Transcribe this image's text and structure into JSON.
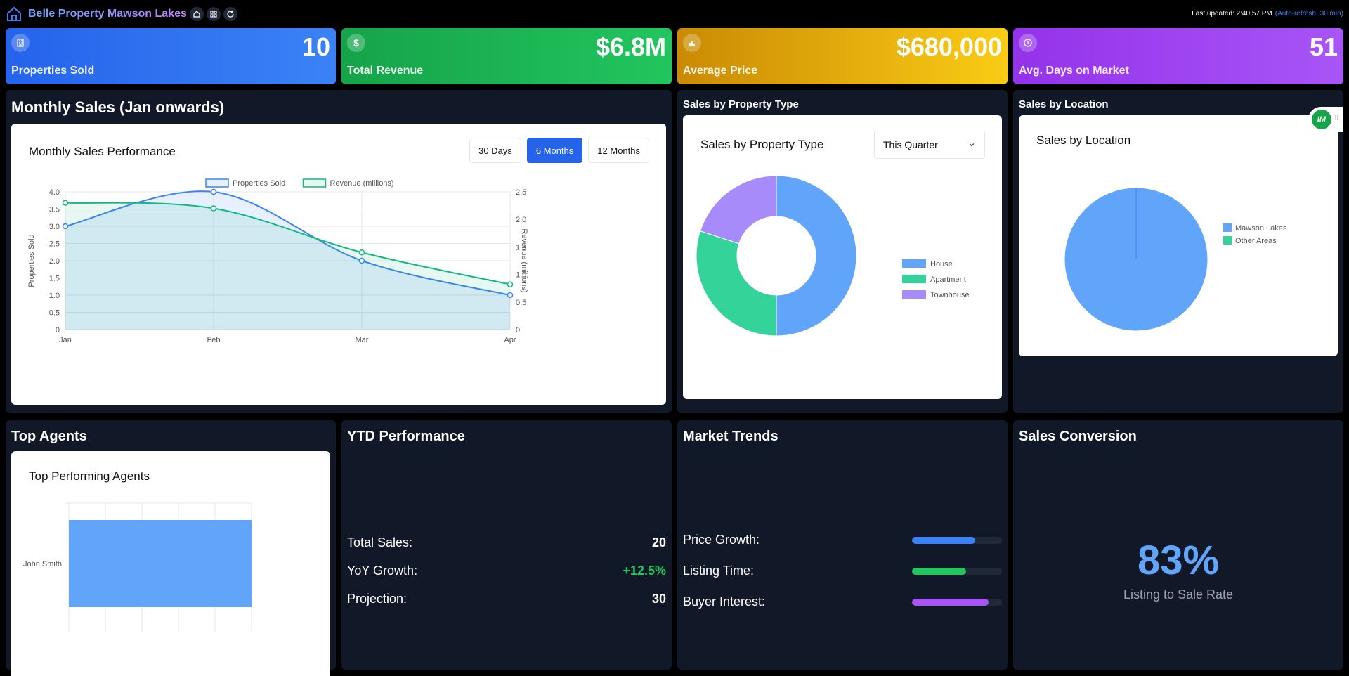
{
  "header": {
    "title": "Belle Property Mawson Lakes",
    "last_updated": "Last updated: 2:40:57 PM",
    "auto_refresh": "(Auto-refresh: 30 min)"
  },
  "kpis": [
    {
      "value": "10",
      "label": "Properties Sold",
      "icon": "building-icon"
    },
    {
      "value": "$6.8M",
      "label": "Total Revenue",
      "icon": "dollar-icon"
    },
    {
      "value": "$680,000",
      "label": "Average Price",
      "icon": "bar-chart-icon"
    },
    {
      "value": "51",
      "label": "Avg. Days on Market",
      "icon": "clock-icon"
    }
  ],
  "monthly": {
    "panel_title": "Monthly Sales (Jan onwards)",
    "card_title": "Monthly Sales Performance",
    "ranges": [
      "30 Days",
      "6 Months",
      "12 Months"
    ],
    "active_range": "6 Months"
  },
  "property_type": {
    "panel_title": "Sales by Property Type",
    "card_title": "Sales by Property Type",
    "select_value": "This Quarter"
  },
  "location": {
    "panel_title": "Sales by Location",
    "card_title": "Sales by Location"
  },
  "agents": {
    "panel_title": "Top Agents",
    "card_title": "Top Performing Agents"
  },
  "ytd": {
    "panel_title": "YTD Performance",
    "rows": [
      {
        "label": "Total Sales:",
        "value": "20"
      },
      {
        "label": "YoY Growth:",
        "value": "+12.5%"
      },
      {
        "label": "Projection:",
        "value": "30"
      }
    ]
  },
  "trends": {
    "panel_title": "Market Trends",
    "rows": [
      {
        "label": "Price Growth:",
        "level": 0.7,
        "color": "#3b82f6"
      },
      {
        "label": "Listing Time:",
        "level": 0.6,
        "color": "#22c55e"
      },
      {
        "label": "Buyer Interest:",
        "level": 0.85,
        "color": "#a855f7"
      }
    ]
  },
  "conversion": {
    "panel_title": "Sales Conversion",
    "value": "83%",
    "label": "Listing to Sale Rate"
  },
  "chart_data": [
    {
      "type": "line",
      "title": "Monthly Sales Performance",
      "x": [
        "Jan",
        "Feb",
        "Mar",
        "Apr"
      ],
      "series": [
        {
          "name": "Properties Sold",
          "values": [
            3,
            4,
            2,
            1
          ],
          "axis": "left",
          "color": "#3b82f6"
        },
        {
          "name": "Revenue (millions)",
          "values": [
            2.3,
            2.2,
            1.4,
            0.82
          ],
          "axis": "right",
          "color": "#10b981"
        }
      ],
      "ylabel": "Properties Sold",
      "y2label": "Revenue (millions)",
      "ylim": [
        0,
        4
      ],
      "y2lim": [
        0,
        2.5
      ],
      "yticks": [
        "0",
        "0.5",
        "1.0",
        "1.5",
        "2.0",
        "2.5",
        "3.0",
        "3.5",
        "4.0"
      ],
      "y2ticks": [
        "0",
        "0.5",
        "1.0",
        "1.5",
        "2.0",
        "2.5"
      ],
      "grid": true,
      "legend": "top"
    },
    {
      "type": "pie",
      "title": "Sales by Property Type",
      "categories": [
        "House",
        "Apartment",
        "Townhouse"
      ],
      "values": [
        5,
        3,
        2
      ],
      "colors": [
        "#60a5fa",
        "#34d399",
        "#a78bfa"
      ],
      "legend": "right"
    },
    {
      "type": "pie",
      "title": "Sales by Location",
      "categories": [
        "Mawson Lakes",
        "Other Areas"
      ],
      "values": [
        10,
        0
      ],
      "colors": [
        "#60a5fa",
        "#34d399"
      ],
      "legend": "right"
    },
    {
      "type": "bar",
      "title": "Top Performing Agents",
      "categories": [
        "John Smith"
      ],
      "values": [
        10
      ],
      "colors": [
        "#60a5fa"
      ]
    }
  ]
}
